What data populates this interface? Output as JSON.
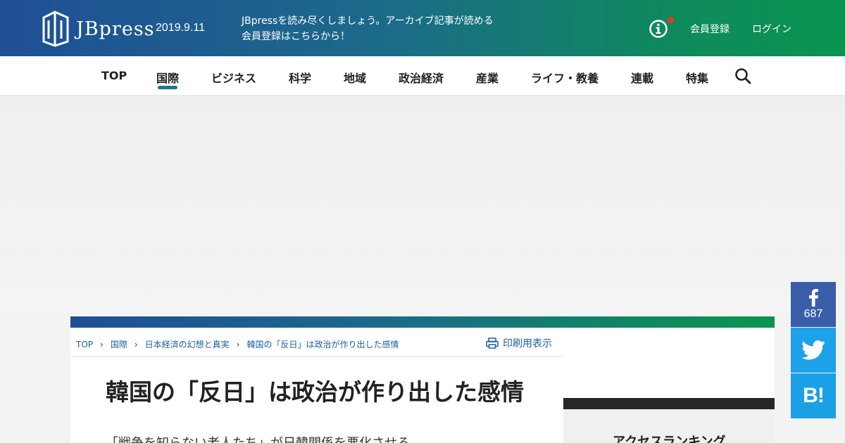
{
  "header": {
    "logo_text": "JBpress",
    "date": "2019.9.11",
    "promo_text": "JBpressを読み尽くしましょう。アーカイブ記事が読める会員登録はこちらから！",
    "register": "会員登録",
    "login": "ログイン"
  },
  "nav": {
    "items": [
      "TOP",
      "国際",
      "ビジネス",
      "科学",
      "地域",
      "政治経済",
      "産業",
      "ライフ・教養",
      "連載",
      "特集"
    ],
    "active": "国際"
  },
  "breadcrumb": [
    "TOP",
    "国際",
    "日本経済の幻想と真実",
    "韓国の「反日」は政治が作り出した感情"
  ],
  "print_label": "印刷用表示",
  "article": {
    "title": "韓国の「反日」は政治が作り出した感情",
    "subtitle": "「戦争を知らない老人たち」が日韓関係を悪化させる"
  },
  "ranking": {
    "title": "アクセスランキング"
  },
  "social": {
    "facebook_count": "687",
    "hatena_label": "B!"
  },
  "colors": {
    "header_start": "#1f4f95",
    "header_end": "#0a9450",
    "link": "#1b5fa0",
    "facebook": "#3a5da8",
    "twitter": "#1da1e8",
    "hatena": "#1ba0e5"
  }
}
